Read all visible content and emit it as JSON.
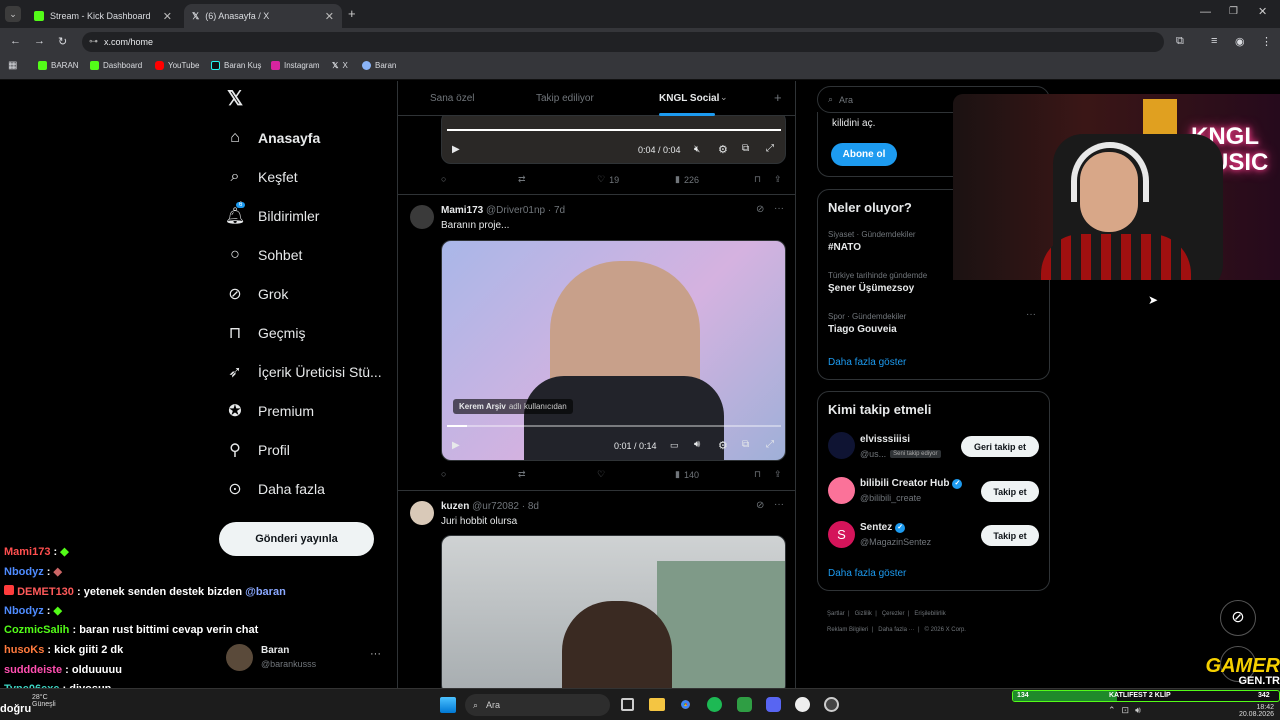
{
  "browser": {
    "tabs": [
      {
        "title": "Stream - Kick Dashboard",
        "favicon_color": "#53fc18"
      },
      {
        "title": "(6) Anasayfa / X"
      }
    ],
    "url": "x.com/home",
    "bookmarks": [
      "BARAN",
      "Dashboard",
      "YouTube",
      "Baran Kuş",
      "Instagram",
      "X",
      "Baran"
    ]
  },
  "nav": {
    "items": [
      {
        "label": "Anasayfa",
        "icon": "home-icon"
      },
      {
        "label": "Keşfet",
        "icon": "search-icon"
      },
      {
        "label": "Bildirimler",
        "icon": "bell-icon",
        "badge": "6"
      },
      {
        "label": "Sohbet",
        "icon": "chat-icon"
      },
      {
        "label": "Grok",
        "icon": "grok-icon"
      },
      {
        "label": "Geçmiş",
        "icon": "bookmark-icon"
      },
      {
        "label": "İçerik Üreticisi Stü...",
        "icon": "rocket-icon"
      },
      {
        "label": "Premium",
        "icon": "verified-icon"
      },
      {
        "label": "Profil",
        "icon": "person-icon"
      },
      {
        "label": "Daha fazla",
        "icon": "more-circle-icon"
      }
    ],
    "post_button": "Gönderi yayınla",
    "account": {
      "name": "Baran",
      "handle": "@barankusss"
    }
  },
  "feed": {
    "tabs": [
      "Sana özel",
      "Takip ediliyor",
      "KNGL Social"
    ],
    "video1": {
      "time": "0:04 / 0:04"
    },
    "post1_actions": {
      "likes": "19",
      "views": "226"
    },
    "posts": [
      {
        "name": "Mami173",
        "handle": "@Driver01np",
        "time": "· 7d",
        "text": "Baranın proje...",
        "video_label_user": "Kerem Arşiv",
        "video_label_suffix": "adlı kullanıcıdan",
        "video_time": "0:01 / 0:14",
        "views": "140"
      },
      {
        "name": "kuzen",
        "handle": "@ur72082",
        "time": "· 8d",
        "text": "Juri hobbit olursa"
      }
    ]
  },
  "right": {
    "search_placeholder": "Ara",
    "premium": {
      "text": "kilidini aç.",
      "button": "Abone ol"
    },
    "trends": {
      "title": "Neler oluyor?",
      "items": [
        {
          "context": "Siyaset · Gündemdekiler",
          "name": "#NATO"
        },
        {
          "context": "Türkiye tarihinde gündemde",
          "name": "Şener Üşümezsoy"
        },
        {
          "context": "Spor · Gündemdekiler",
          "name": "Tiago Gouveia"
        }
      ],
      "more": "Daha fazla göster"
    },
    "follow": {
      "title": "Kimi takip etmeli",
      "items": [
        {
          "name": "elvisssiiisi",
          "handle": "@us...",
          "badge": "Seni takip ediyor",
          "button": "Geri takip et"
        },
        {
          "name": "bilibili Creator Hub",
          "handle": "@bilibili_create",
          "button": "Takip et"
        },
        {
          "name": "Sentez",
          "handle": "@MagazinSentez",
          "button": "Takip et"
        }
      ],
      "more": "Daha fazla göster"
    },
    "footer": [
      "Şartlar",
      "Gizlilik",
      "Çerezler",
      "Erişilebilirlik",
      "Reklam Bilgileri",
      "Daha fazla ···",
      "© 2026 X Corp."
    ]
  },
  "stream_overlay": {
    "logo_text": "KNGL MUSIC",
    "brand": "GAMER",
    "brand_sub": "GEN.TR",
    "bar_count": "134",
    "bar_title": "KATLIFEST 2 KLİP",
    "bar_right": "342"
  },
  "chat": [
    {
      "user": "Mami173",
      "color": "#ff4f4f",
      "msg": ":"
    },
    {
      "user": "Nbodyz",
      "color": "#4f8cff",
      "msg": ":"
    },
    {
      "user": "DEMET130",
      "color": "#ff5a5a",
      "msg": ": yetenek senden destek bizden",
      "mention": "@baran"
    },
    {
      "user": "Nbodyz",
      "color": "#4f8cff",
      "msg": ":"
    },
    {
      "user": "CozmicSalih",
      "color": "#53fc18",
      "msg": ": baran rust bittimi cevap verin chat"
    },
    {
      "user": "husoKs",
      "color": "#ff7a3d",
      "msg": ": kick giiti 2 dk"
    },
    {
      "user": "sudddeiste",
      "color": "#ff4fb0",
      "msg": ": olduuuuu"
    },
    {
      "user": "Tyne06exe",
      "color": "#3dd6c3",
      "msg": ": diyosun"
    }
  ],
  "taskbar": {
    "weather_temp": "28°C",
    "weather_label": "Güneşli",
    "search": "Ara",
    "time": "18:42",
    "date": "20.08.2026",
    "partial_text": "doğru"
  }
}
